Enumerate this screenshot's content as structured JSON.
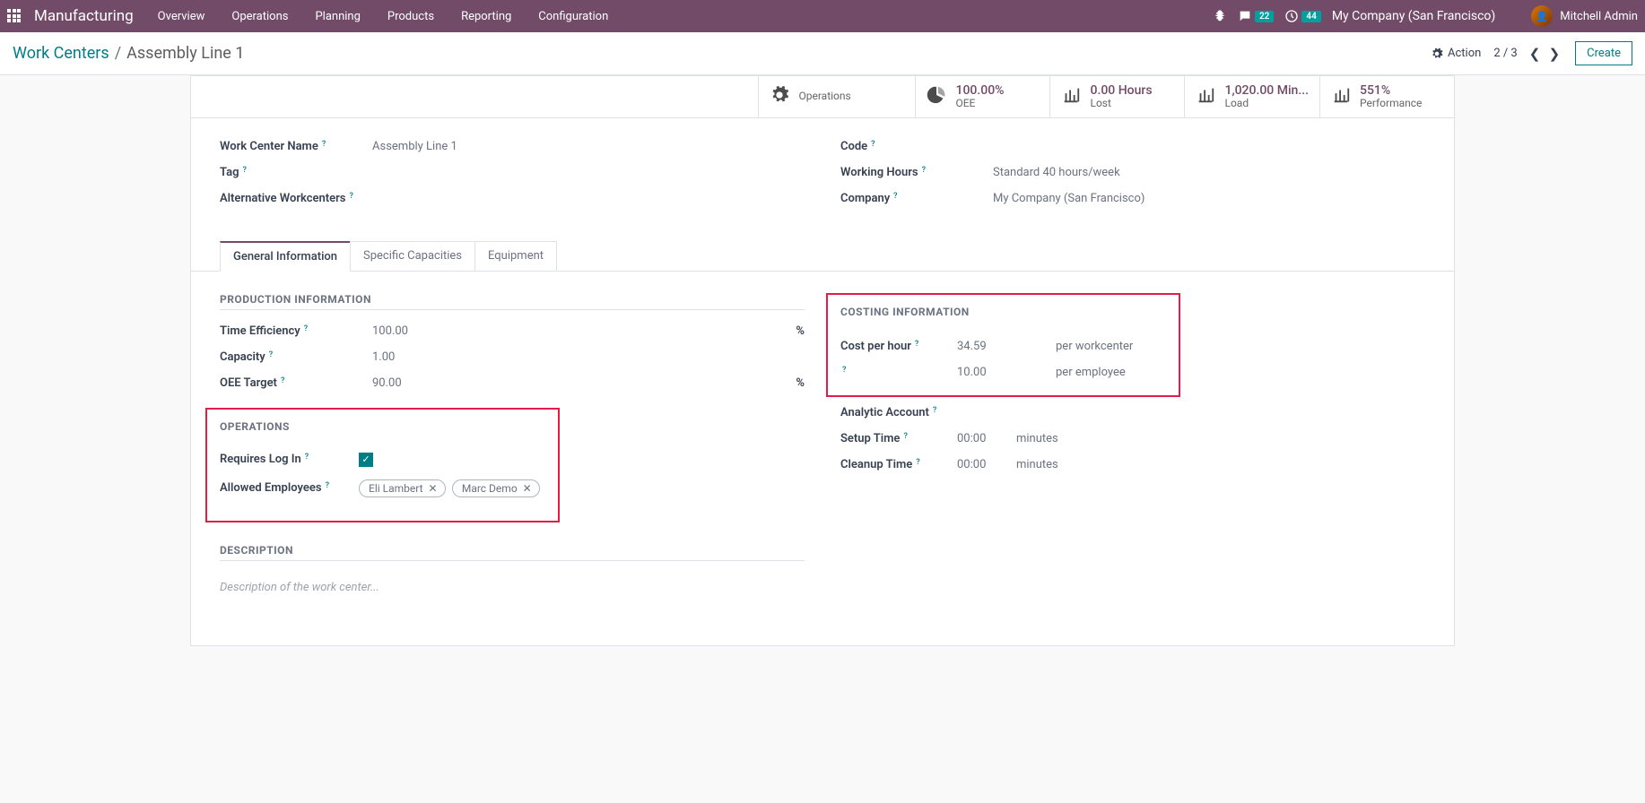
{
  "navbar": {
    "brand": "Manufacturing",
    "links": [
      "Overview",
      "Operations",
      "Planning",
      "Products",
      "Reporting",
      "Configuration"
    ],
    "badge_msg": "22",
    "badge_clock": "44",
    "company": "My Company (San Francisco)",
    "user": "Mitchell Admin"
  },
  "breadcrumb": {
    "root": "Work Centers",
    "current": "Assembly Line 1"
  },
  "topbar": {
    "action_label": "Action",
    "pager": "2 / 3",
    "create_label": "Create"
  },
  "stats": {
    "operations_label": "Operations",
    "oee_value": "100.00%",
    "oee_label": "OEE",
    "lost_value": "0.00 Hours",
    "lost_label": "Lost",
    "load_value": "1,020.00 Min...",
    "load_label": "Load",
    "perf_value": "551%",
    "perf_label": "Performance"
  },
  "fields": {
    "name_label": "Work Center Name",
    "name_value": "Assembly Line 1",
    "tag_label": "Tag",
    "alt_label": "Alternative Workcenters",
    "code_label": "Code",
    "hours_label": "Working Hours",
    "hours_value": "Standard 40 hours/week",
    "company_label": "Company",
    "company_value": "My Company (San Francisco)"
  },
  "tabs": [
    "General Information",
    "Specific Capacities",
    "Equipment"
  ],
  "sections": {
    "production": "PRODUCTION INFORMATION",
    "operations": "OPERATIONS",
    "description": "DESCRIPTION",
    "costing": "COSTING INFORMATION"
  },
  "production": {
    "eff_label": "Time Efficiency",
    "eff_value": "100.00",
    "eff_unit": "%",
    "cap_label": "Capacity",
    "cap_value": "1.00",
    "oee_label": "OEE Target",
    "oee_value": "90.00",
    "oee_unit": "%"
  },
  "operations": {
    "login_label": "Requires Log In",
    "emp_label": "Allowed Employees",
    "emp1": "Eli Lambert",
    "emp2": "Marc Demo"
  },
  "costing": {
    "cph_label": "Cost per hour",
    "cph_value": "34.59",
    "cph_note": "per workcenter",
    "pe_value": "10.00",
    "pe_note": "per employee",
    "analytic_label": "Analytic Account",
    "setup_label": "Setup Time",
    "setup_value": "00:00",
    "cleanup_label": "Cleanup Time",
    "cleanup_value": "00:00",
    "time_unit": "minutes"
  },
  "desc_placeholder": "Description of the work center..."
}
